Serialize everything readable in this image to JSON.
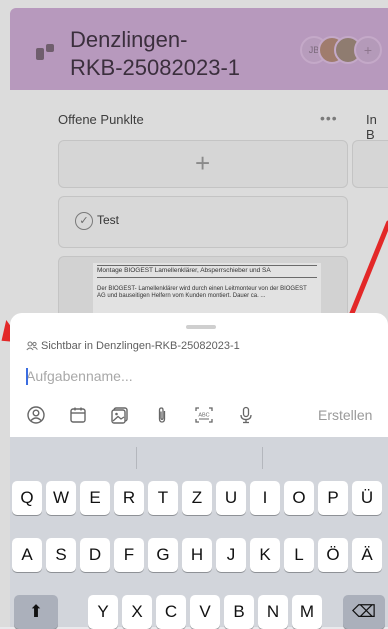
{
  "board": {
    "title": "Denzlingen-\nRKB-25082023-1",
    "avatar_initials": "JB",
    "avatar_plus": "+",
    "column_title": "Offene Punklte",
    "column_menu": "•••",
    "next_column_title": "In B",
    "add_card": "+",
    "card": {
      "label": "Test"
    },
    "doc_preview": {
      "line1": "Montage BIOGEST Lamellenklärer, Absperrschieber und SA",
      "para": "Der BIOGEST- Lamellenklärer wird durch einen Leitmonteur von der BIOGEST AG und bauseitigen Helfern vom Kunden montiert. Dauer ca. ... "
    }
  },
  "sheet": {
    "visibility_text": "Sichtbar in Denzlingen-RKB-25082023-1",
    "task_input": {
      "value": "",
      "placeholder": "Aufgabenname..."
    },
    "tools": [
      "person-icon",
      "calendar-icon",
      "image-icon",
      "paperclip-icon",
      "text-scan-icon",
      "microphone-icon"
    ],
    "create_label": "Erstellen"
  },
  "keyboard": {
    "row1": [
      "Q",
      "W",
      "E",
      "R",
      "T",
      "Z",
      "U",
      "I",
      "O",
      "P",
      "Ü"
    ],
    "row2": [
      "A",
      "S",
      "D",
      "F",
      "G",
      "H",
      "J",
      "K",
      "L",
      "Ö",
      "Ä"
    ],
    "row3": [
      "Y",
      "X",
      "C",
      "V",
      "B",
      "N",
      "M"
    ],
    "shift": "⬆",
    "backspace": "⌫"
  },
  "colors": {
    "header": "#b799bd",
    "arrow": "#e32828",
    "caret": "#3b6de0"
  }
}
